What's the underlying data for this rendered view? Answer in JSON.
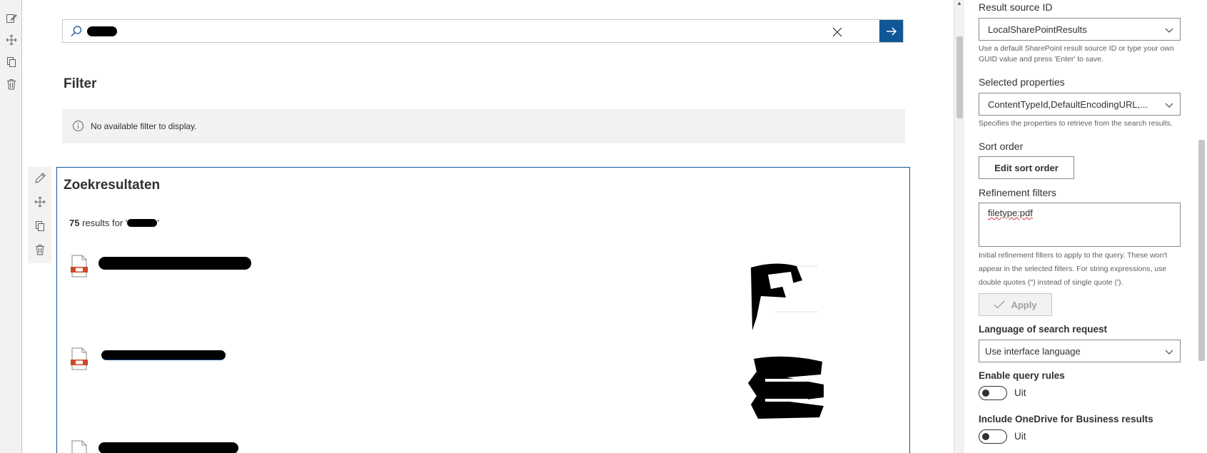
{
  "search": {
    "value": "",
    "placeholder": ""
  },
  "filter": {
    "title": "Filter",
    "message": "No available filter to display."
  },
  "results": {
    "title": "Zoekresultaten",
    "count": "75",
    "count_suffix": "results for '",
    "count_close": "'",
    "items": [
      {
        "title": ""
      },
      {
        "title": ""
      },
      {
        "title": ""
      }
    ]
  },
  "pane": {
    "result_source_label": "Result source ID",
    "result_source_value": "LocalSharePointResults",
    "result_source_help": "Use a default SharePoint result source ID or type your own GUID value and press 'Enter' to save.",
    "selected_props_label": "Selected properties",
    "selected_props_value": "ContentTypeId,DefaultEncodingURL,...",
    "selected_props_help": "Specifies the properties to retrieve from the search results.",
    "sort_order_label": "Sort order",
    "sort_order_button": "Edit sort order",
    "refinement_label": "Refinement filters",
    "refinement_value": "filetype:pdf",
    "refinement_help": "Initial refinement filters to apply to the query. These won't appear in the selected filters. For string expressions, use double quotes (\") instead of single quote (').",
    "apply_button": "Apply",
    "language_label": "Language of search request",
    "language_value": "Use interface language",
    "query_rules_label": "Enable query rules",
    "query_rules_state": "Uit",
    "onedrive_label": "Include OneDrive for Business results",
    "onedrive_state": "Uit"
  },
  "colors": {
    "accent": "#0f5796",
    "file_icon": "#d24726"
  }
}
